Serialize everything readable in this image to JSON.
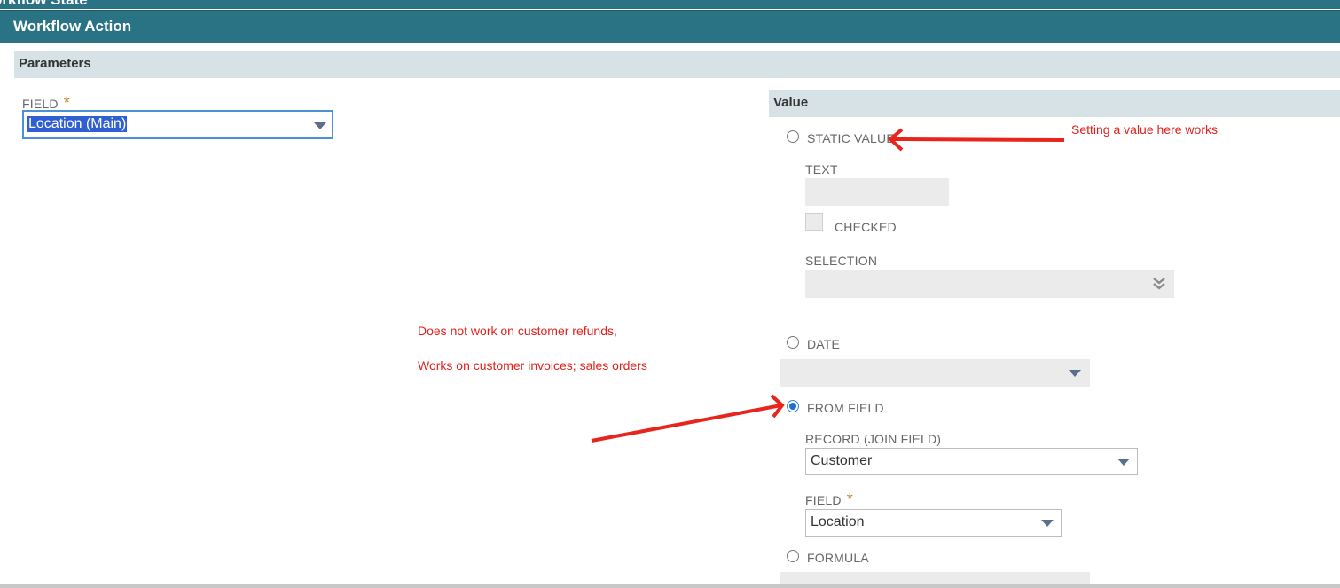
{
  "header": {
    "partial_title": "orkflow State",
    "title": "Workflow Action"
  },
  "parameters": {
    "section_title": "Parameters",
    "field_label": "FIELD",
    "required_mark": "*",
    "field_value": "Location (Main)"
  },
  "value_panel": {
    "section_title": "Value",
    "static_value_label": "STATIC VALUE",
    "text_label": "TEXT",
    "text_value": "",
    "checked_label": "CHECKED",
    "selection_label": "SELECTION",
    "date_label": "DATE",
    "from_field_label": "FROM FIELD",
    "record_label": "RECORD (JOIN FIELD)",
    "record_value": "Customer",
    "field_label": "FIELD",
    "required_mark": "*",
    "field_value": "Location",
    "formula_label": "FORMULA",
    "selected_option": "FROM FIELD"
  },
  "annotations": {
    "static_note": "Setting a value here works",
    "refund_note": "Does not work on customer refunds,",
    "invoice_note": "Works on customer invoices; sales orders"
  },
  "colors": {
    "header_bg": "#2a7385",
    "section_bg": "#d6e2e6",
    "annotation": "#e0201c",
    "required": "#c0892a"
  },
  "icons": [
    "dropdown-caret-icon",
    "double-chevron-icon",
    "annotation-arrow-icon"
  ]
}
